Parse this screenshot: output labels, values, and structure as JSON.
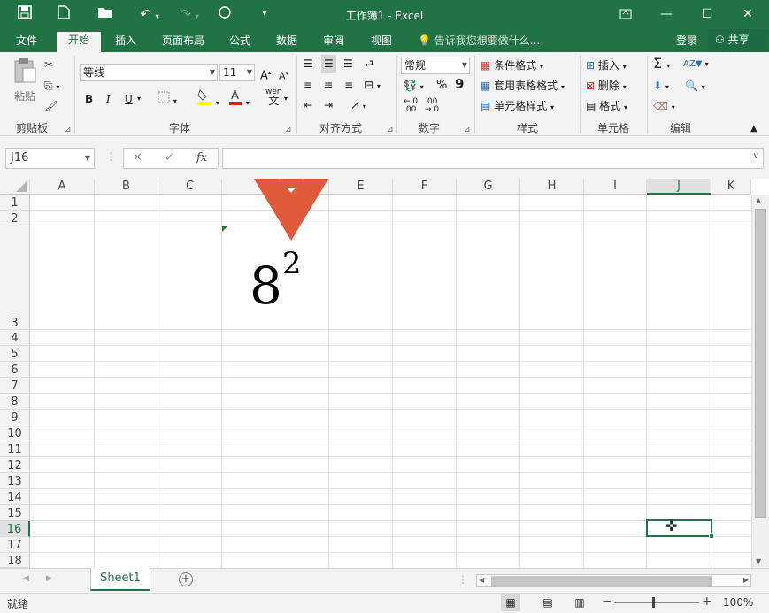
{
  "window": {
    "title": "工作簿1 - Excel"
  },
  "quick_access": {
    "save_icon": "save-icon",
    "new_icon": "new-file-icon",
    "open_icon": "open-folder-icon",
    "undo_icon": "undo-icon",
    "redo_icon": "redo-icon",
    "touch_icon": "touch-mode-icon"
  },
  "tabs": [
    "文件",
    "开始",
    "插入",
    "页面布局",
    "公式",
    "数据",
    "审阅",
    "视图"
  ],
  "active_tab": "开始",
  "tell_me": "告诉我您想要做什么...",
  "login": "登录",
  "share": "共享",
  "ribbon": {
    "clipboard": {
      "paste": "粘贴",
      "label": "剪贴板"
    },
    "font": {
      "name": "等线",
      "size": "11",
      "bold": "B",
      "italic": "I",
      "underline": "U",
      "grow": "A",
      "shrink": "A",
      "wen": "wén",
      "label": "字体"
    },
    "alignment": {
      "label": "对齐方式"
    },
    "number": {
      "format": "常规",
      "percent": "%",
      "comma": "9",
      "label": "数字"
    },
    "styles": {
      "conditional": "条件格式",
      "table": "套用表格格式",
      "cell": "单元格样式",
      "label": "样式"
    },
    "cells": {
      "insert": "插入",
      "delete": "删除",
      "format": "格式",
      "label": "单元格"
    },
    "editing": {
      "label": "编辑"
    }
  },
  "formula_bar": {
    "name_box": "J16",
    "cancel": "✕",
    "enter": "✓",
    "fx": "fx",
    "value": ""
  },
  "columns": [
    "A",
    "B",
    "C",
    "D",
    "E",
    "F",
    "G",
    "H",
    "I",
    "J",
    "K"
  ],
  "rows": [
    "1",
    "2",
    "3",
    "4",
    "5",
    "6",
    "7",
    "8",
    "9",
    "10",
    "11",
    "12",
    "13",
    "14",
    "15",
    "16",
    "17",
    "18"
  ],
  "selected_cell": {
    "col": "J",
    "row": "16"
  },
  "cell_D3": {
    "base": "8",
    "exponent": "2"
  },
  "sheet": {
    "tab": "Sheet1",
    "add": "+"
  },
  "status": {
    "ready": "就绪",
    "zoom": "100%",
    "minus": "−",
    "plus": "+"
  },
  "colors": {
    "excel_green": "#217346",
    "arrow": "#e05a3a"
  }
}
